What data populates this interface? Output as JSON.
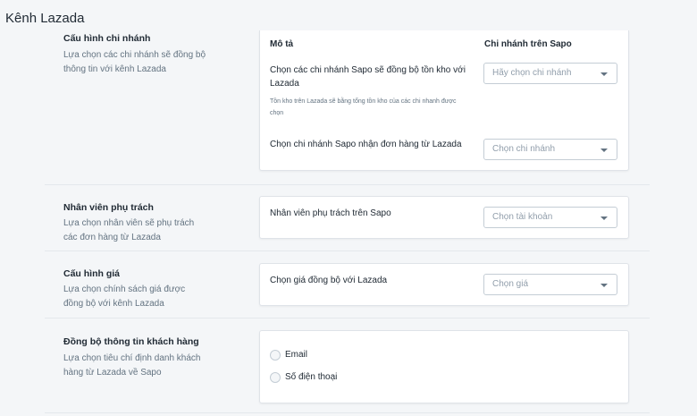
{
  "page": {
    "title": "Kênh Lazada"
  },
  "branch_config": {
    "title": "Cấu hình chi nhánh",
    "description": "Lựa chọn các chi nhánh sẽ đồng bộ thông tin với kênh Lazada",
    "col_desc": "Mô tả",
    "col_branch": "Chi nhánh trên Sapo",
    "row1_label": "Chọn các chi nhánh Sapo sẽ đồng bộ tồn kho với Lazada",
    "row1_note": "Tồn kho trên Lazada sẽ bằng tổng tồn kho của các chi nhanh được chọn",
    "row1_placeholder": "Hãy chọn chi nhánh",
    "row2_label": "Chọn chi nhánh Sapo nhận đơn hàng từ Lazada",
    "row2_placeholder": "Chọn chi nhánh"
  },
  "staff": {
    "title": "Nhân viên phụ trách",
    "description": "Lựa chọn nhân viên sẽ phụ trách các đơn hàng từ Lazada",
    "label": "Nhân viên phụ trách trên Sapo",
    "placeholder": "Chọn tài khoản"
  },
  "price": {
    "title": "Cấu hình giá",
    "description": "Lựa chọn chính sách giá được đồng bộ với kênh Lazada",
    "label": "Chọn giá đồng bộ với Lazada",
    "placeholder": "Chọn giá"
  },
  "customer_sync": {
    "title": "Đồng bộ thông tin khách hàng",
    "description": "Lựa chọn tiêu chí định danh khách hàng từ Lazada về Sapo",
    "options": [
      {
        "label": "Email"
      },
      {
        "label": "Số điện thoại"
      }
    ]
  }
}
